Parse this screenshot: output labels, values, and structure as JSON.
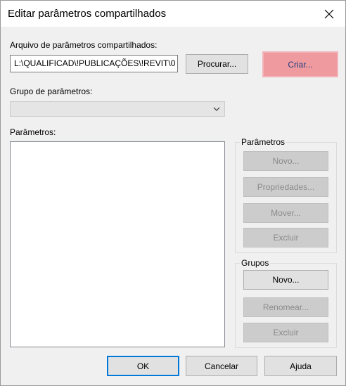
{
  "window": {
    "title": "Editar parâmetros compartilhados"
  },
  "file": {
    "label": "Arquivo de parâmetros compartilhados:",
    "path": "L:\\QUALIFICAD\\!PUBLICAÇÕES\\!REVIT\\0",
    "browse_label": "Procurar...",
    "create_label": "Criar..."
  },
  "param_group": {
    "label": "Grupo de parâmetros:",
    "selected": ""
  },
  "parameters_list": {
    "label": "Parâmetros:"
  },
  "parameters_box": {
    "title": "Parâmetros",
    "new_label": "Novo...",
    "properties_label": "Propriedades...",
    "move_label": "Mover...",
    "delete_label": "Excluir"
  },
  "groups_box": {
    "title": "Grupos",
    "new_label": "Novo...",
    "rename_label": "Renomear...",
    "delete_label": "Excluir"
  },
  "footer": {
    "ok_label": "OK",
    "cancel_label": "Cancelar",
    "help_label": "Ajuda"
  }
}
